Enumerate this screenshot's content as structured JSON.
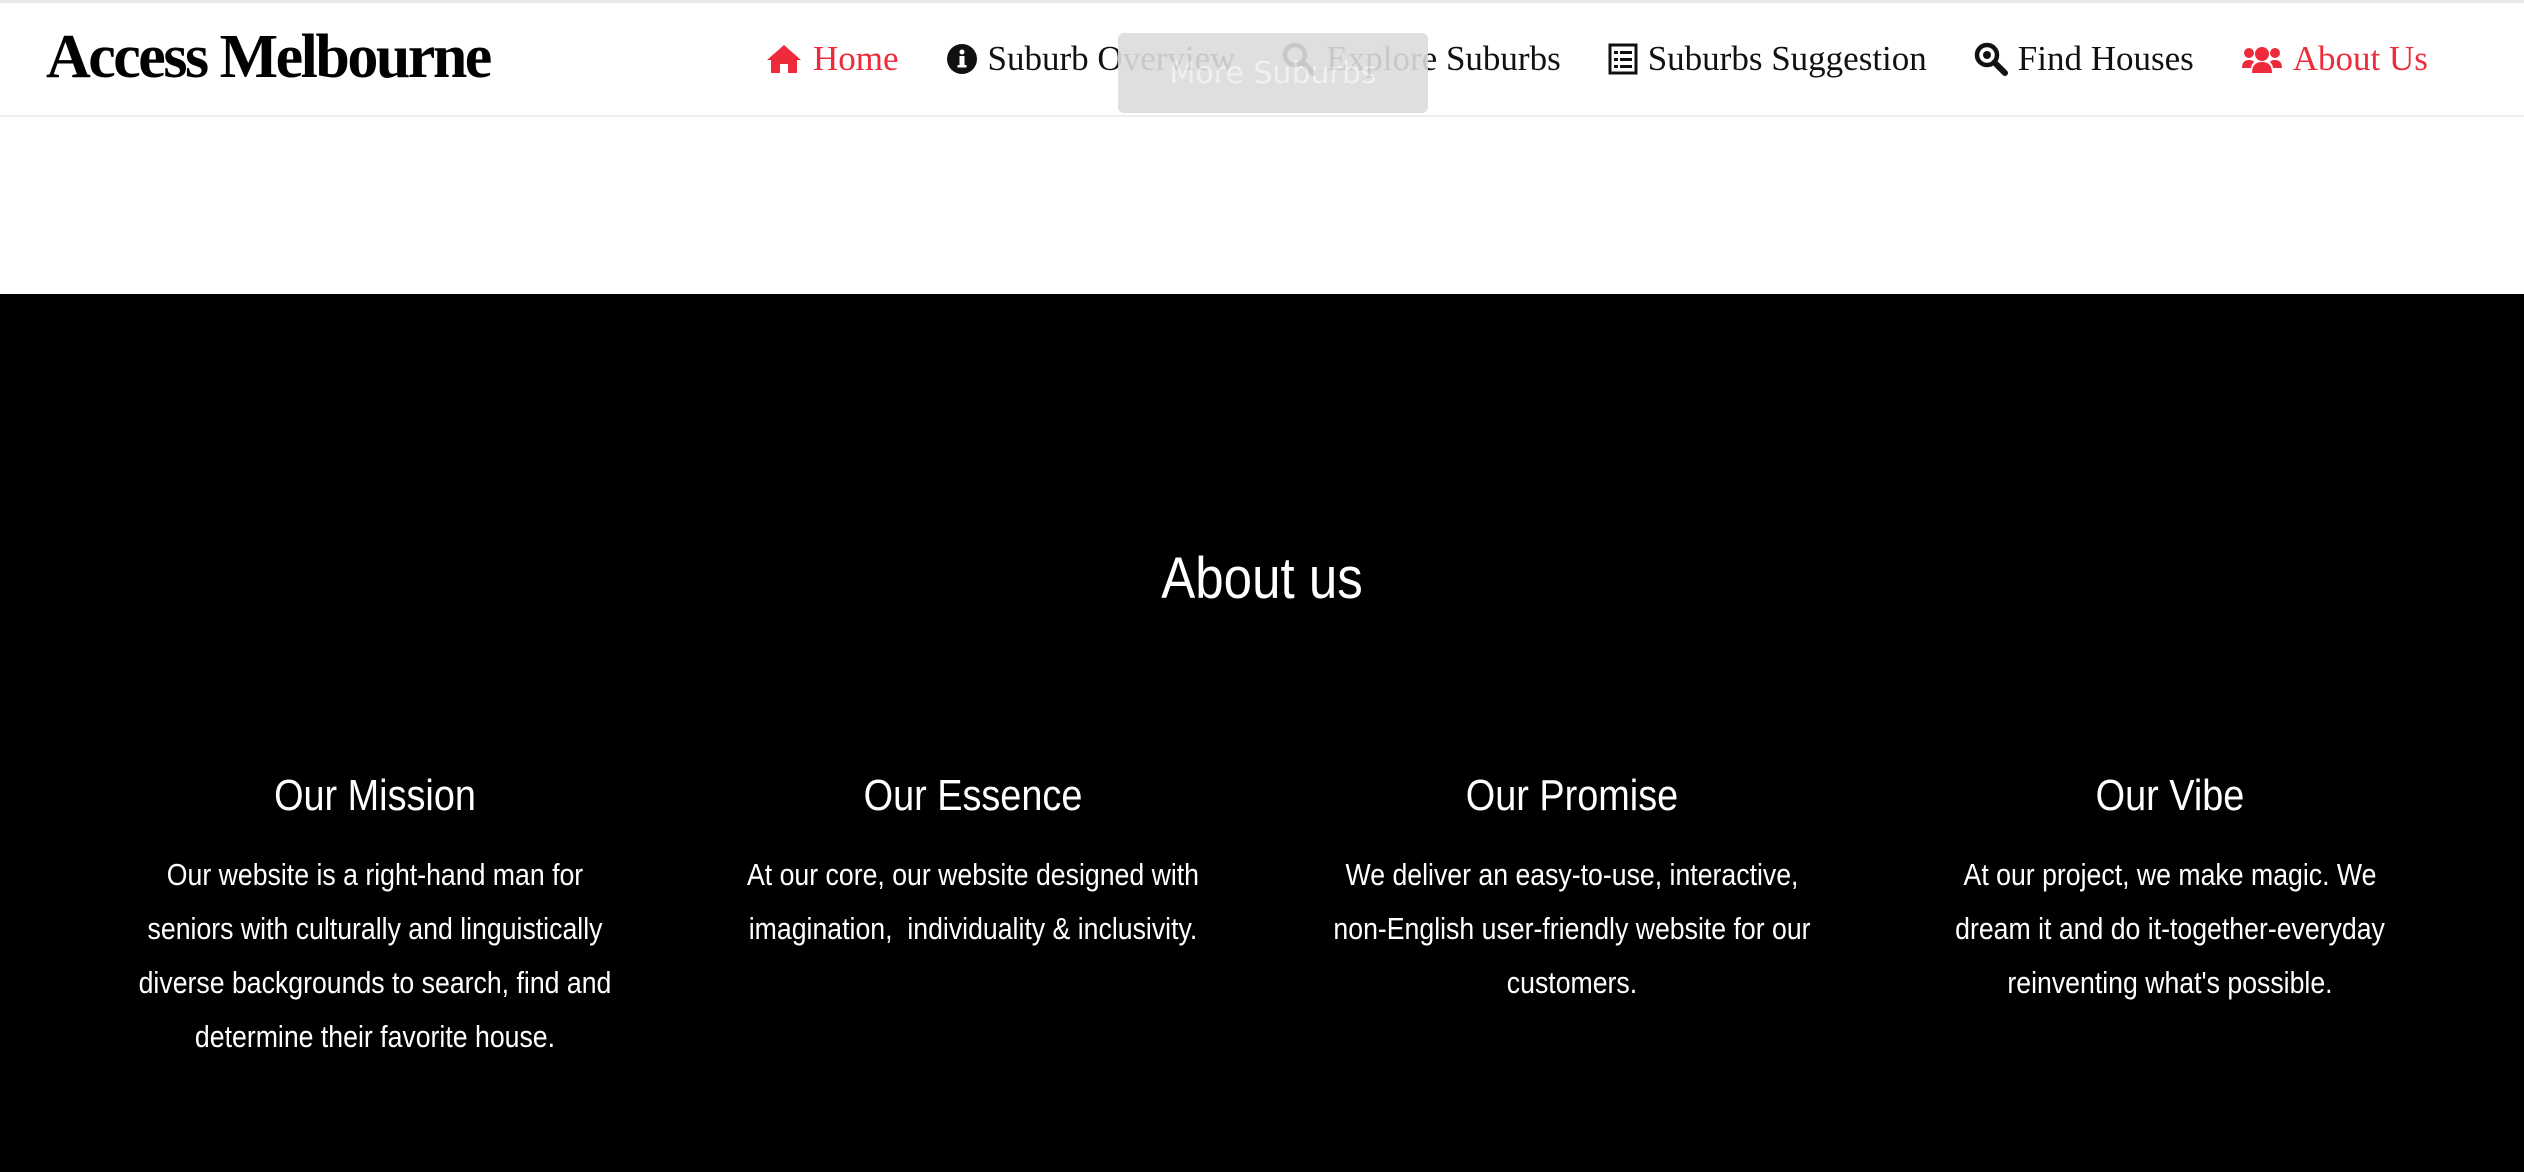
{
  "accent_color": "#ee2b3b",
  "header": {
    "logo": "Access Melbourne",
    "ghost_button": "More Suburbs",
    "nav": [
      {
        "label": "Home",
        "icon": "home-icon",
        "active": true
      },
      {
        "label": "Suburb Overview",
        "icon": "info-circle-icon",
        "active": false
      },
      {
        "label": "Explore Suburbs",
        "icon": "search-icon",
        "active": false
      },
      {
        "label": "Suburbs Suggestion",
        "icon": "list-card-icon",
        "active": false
      },
      {
        "label": "Find Houses",
        "icon": "search-house-icon",
        "active": false
      },
      {
        "label": "About Us",
        "icon": "users-icon",
        "active": true
      }
    ]
  },
  "about": {
    "title": "About us",
    "columns": [
      {
        "heading": "Our Mission",
        "lines": [
          "Our website is a right-hand man for",
          "seniors with culturally and linguistically",
          "diverse backgrounds to search, find and",
          "determine their favorite house."
        ]
      },
      {
        "heading": "Our Essence",
        "lines": [
          "At our core, our website designed with",
          "imagination,  individuality & inclusivity."
        ]
      },
      {
        "heading": "Our Promise",
        "lines": [
          "We deliver an easy-to-use, interactive,",
          "non-English user-friendly website for our",
          "customers."
        ]
      },
      {
        "heading": "Our Vibe",
        "lines": [
          "At our project, we make magic. We",
          "dream it and do it-together-everyday",
          "reinventing what's possible."
        ]
      }
    ]
  }
}
